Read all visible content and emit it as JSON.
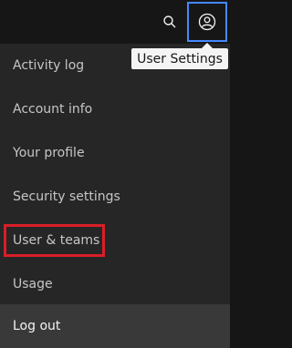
{
  "header": {
    "search_icon": "search-icon",
    "user_icon": "user-avatar-icon"
  },
  "tooltip": {
    "label": "User Settings"
  },
  "menu": {
    "items": [
      {
        "label": "Activity log"
      },
      {
        "label": "Account info"
      },
      {
        "label": "Your profile"
      },
      {
        "label": "Security settings"
      },
      {
        "label": "User & teams"
      },
      {
        "label": "Usage"
      },
      {
        "label": "Log out"
      }
    ]
  },
  "colors": {
    "header_bg": "#161616",
    "menu_bg": "#262626",
    "logout_bg": "#393939",
    "focus_border": "#4589ff",
    "highlight_red": "#da1e28",
    "tooltip_bg": "#f4f4f4"
  }
}
